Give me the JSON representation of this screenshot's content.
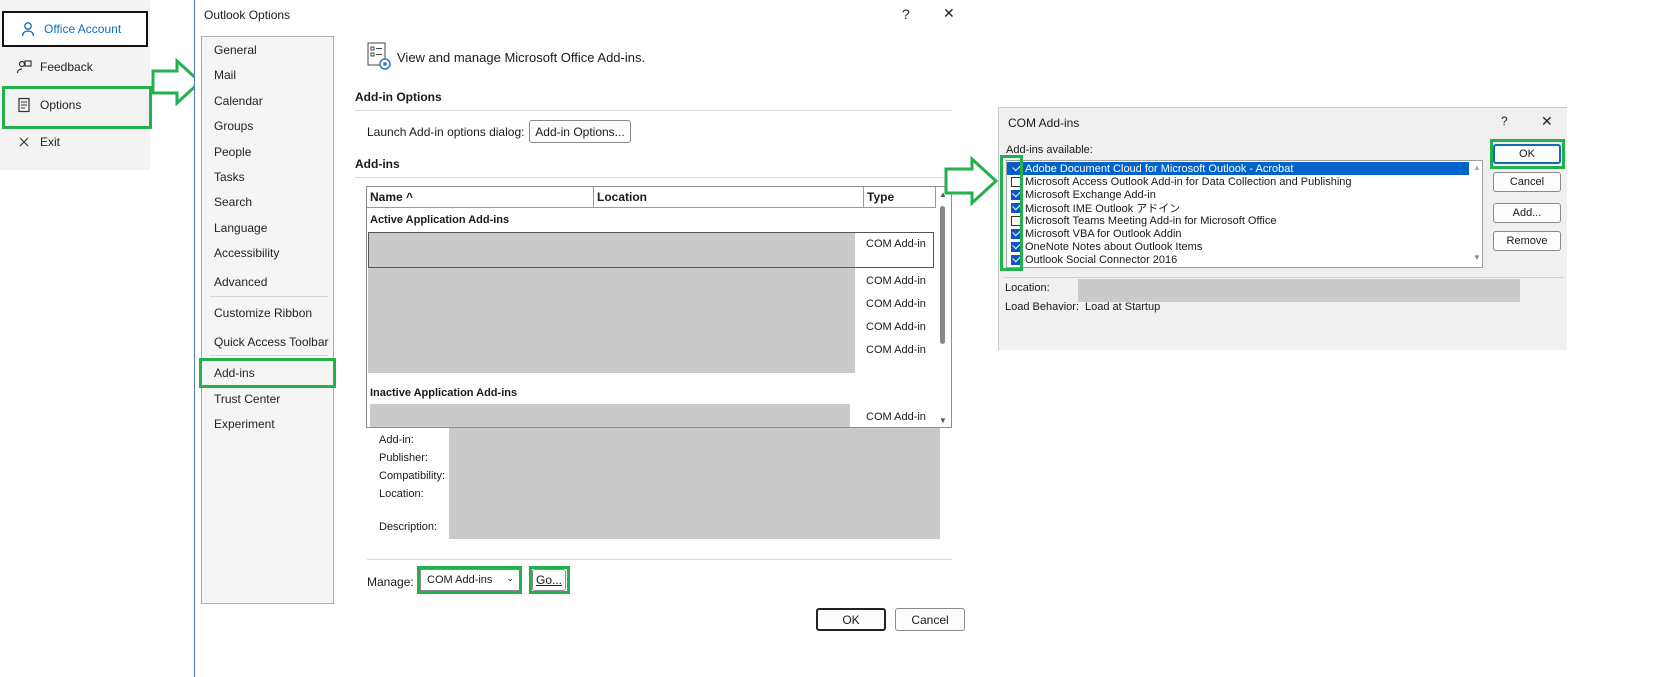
{
  "backstage": {
    "items": [
      {
        "label": "Office Account",
        "icon": "person-icon"
      },
      {
        "label": "Feedback",
        "icon": "feedback-icon"
      },
      {
        "label": "Options",
        "icon": "options-icon"
      },
      {
        "label": "Exit",
        "icon": "close-icon"
      }
    ]
  },
  "options_dialog": {
    "title": "Outlook Options",
    "help": "?",
    "close": "✕",
    "nav": [
      "General",
      "Mail",
      "Calendar",
      "Groups",
      "People",
      "Tasks",
      "Search",
      "Language",
      "Accessibility",
      "Advanced",
      "Customize Ribbon",
      "Quick Access Toolbar",
      "Add-ins",
      "Trust Center",
      "Experiment"
    ],
    "header_text": "View and manage Microsoft Office Add-ins.",
    "addin_options_head": "Add-in Options",
    "launch_label": "Launch Add-in options dialog:",
    "addin_options_btn": "Add-in Options...",
    "addins_head": "Add-ins",
    "columns": [
      "Name ^",
      "Location",
      "Type"
    ],
    "active_group": "Active Application Add-ins",
    "inactive_group": "Inactive Application Add-ins",
    "active_types": [
      "COM Add-in",
      "COM Add-in",
      "COM Add-in",
      "COM Add-in",
      "COM Add-in"
    ],
    "inactive_types": [
      "COM Add-in"
    ],
    "details": {
      "addin": "Add-in:",
      "publisher": "Publisher:",
      "compat": "Compatibility:",
      "location": "Location:",
      "description": "Description:"
    },
    "manage_label": "Manage:",
    "manage_value": "COM Add-ins",
    "go_btn": "Go...",
    "ok_btn": "OK",
    "cancel_btn": "Cancel"
  },
  "com_dialog": {
    "title": "COM Add-ins",
    "help": "?",
    "close": "✕",
    "available_label": "Add-ins available:",
    "items": [
      {
        "label": "Adobe Document Cloud for Microsoft Outlook - Acrobat",
        "checked": true
      },
      {
        "label": "Microsoft Access Outlook Add-in for Data Collection and Publishing",
        "checked": false
      },
      {
        "label": "Microsoft Exchange Add-in",
        "checked": true
      },
      {
        "label": "Microsoft IME Outlook アドイン",
        "checked": true
      },
      {
        "label": "Microsoft Teams Meeting Add-in for Microsoft Office",
        "checked": false
      },
      {
        "label": "Microsoft VBA for Outlook Addin",
        "checked": true
      },
      {
        "label": "OneNote Notes about Outlook Items",
        "checked": true
      },
      {
        "label": "Outlook Social Connector 2016",
        "checked": true
      }
    ],
    "buttons": {
      "ok": "OK",
      "cancel": "Cancel",
      "add": "Add...",
      "remove": "Remove"
    },
    "location_label": "Location:",
    "load_label": "Load Behavior:",
    "load_value": "Load at Startup"
  },
  "colors": {
    "highlight": "#22b14c",
    "accent": "#0f6cbd",
    "selection": "#0063c9"
  }
}
